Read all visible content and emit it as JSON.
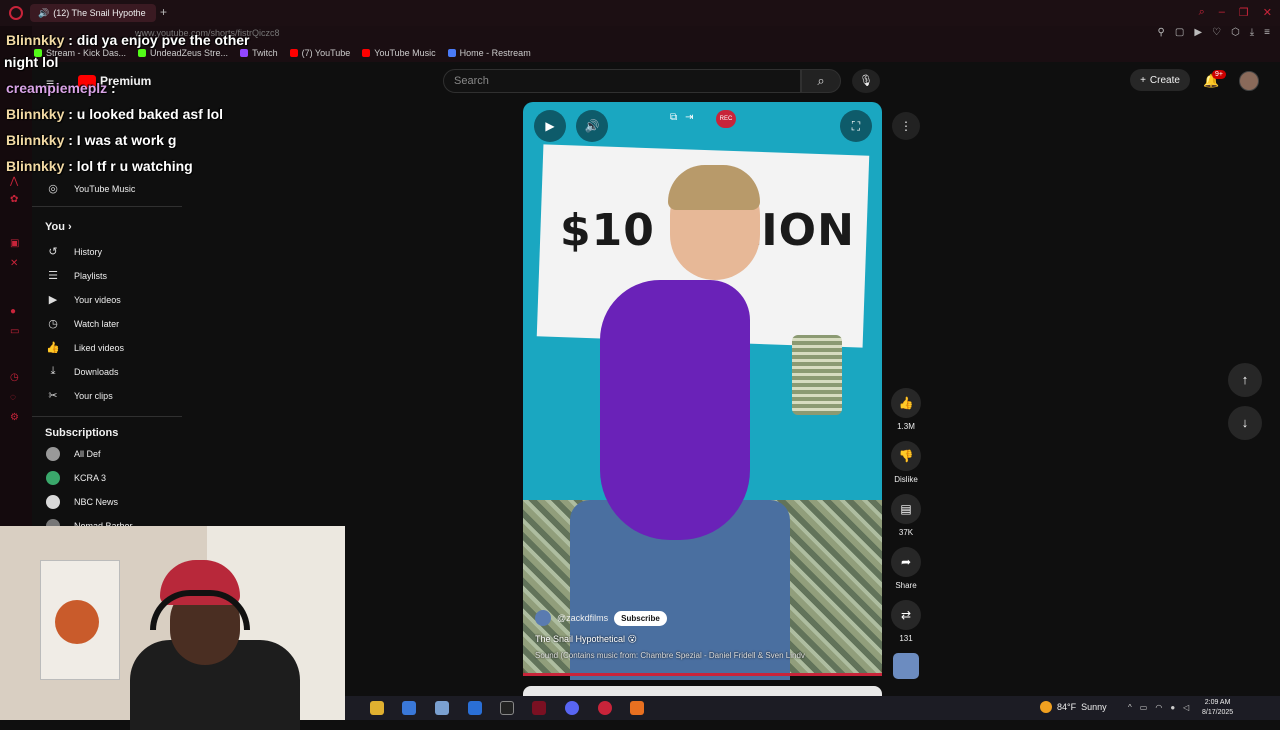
{
  "browser": {
    "tab_title": "(12) The Snail Hypothe",
    "url": "www.youtube.com/shorts/fistrQiczc8",
    "bookmarks": [
      {
        "label": "Stream - Kick Das...",
        "color": "#53fc18"
      },
      {
        "label": "UndeadZeus Stre...",
        "color": "#53fc18"
      },
      {
        "label": "Twitch",
        "color": "#9146ff"
      },
      {
        "label": "(7) YouTube",
        "color": "#ff0000"
      },
      {
        "label": "YouTube Music",
        "color": "#ff0000"
      },
      {
        "label": "Home - Restream",
        "color": "#4a7bf7"
      }
    ]
  },
  "header": {
    "logo_label": "Premium",
    "search_placeholder": "Search",
    "create_label": "Create",
    "notif_count": "9+"
  },
  "sidebar": {
    "music_label": "YouTube Music",
    "you_label": "You",
    "you_items": [
      {
        "label": "History",
        "icon": "history-icon"
      },
      {
        "label": "Playlists",
        "icon": "playlists-icon"
      },
      {
        "label": "Your videos",
        "icon": "your-videos-icon"
      },
      {
        "label": "Watch later",
        "icon": "watch-later-icon"
      },
      {
        "label": "Liked videos",
        "icon": "liked-icon"
      },
      {
        "label": "Downloads",
        "icon": "downloads-icon"
      },
      {
        "label": "Your clips",
        "icon": "clips-icon"
      }
    ],
    "subs_label": "Subscriptions",
    "subs": [
      {
        "label": "All Def",
        "color": "#999999"
      },
      {
        "label": "KCRA 3",
        "color": "#3aa86b"
      },
      {
        "label": "NBC News",
        "color": "#d9d9d9"
      },
      {
        "label": "Nomad Barber",
        "color": "#777777"
      }
    ]
  },
  "chat": [
    {
      "user": "Blinnkky",
      "msg": " : did ya enjoy pve the other"
    },
    {
      "user": "",
      "msg": "night lol"
    },
    {
      "user": "creampiemeplz",
      "msg": " :"
    },
    {
      "user": "Blinnkky",
      "msg": " : u looked baked asf lol"
    },
    {
      "user": "Blinnkky",
      "msg": " : I was at work g"
    },
    {
      "user": "Blinnkky",
      "msg": " : lol tf r u watching"
    }
  ],
  "video": {
    "sign_text": "$10 M LION",
    "channel": "@zackdfilms",
    "subscribe": "Subscribe",
    "title": "The Snail Hypothetical 😮",
    "music": "Sound (Contains music from: Chambre Spezial - Daniel Fridell & Sven Lindv",
    "rec_badge": "REC"
  },
  "actions": {
    "likes": "1.3M",
    "dislike": "Dislike",
    "comments": "37K",
    "share": "Share",
    "remix": "131"
  },
  "taskbar": {
    "temp": "84°F",
    "weather": "Sunny",
    "time": "2:09 AM",
    "date": "8/17/2025"
  }
}
